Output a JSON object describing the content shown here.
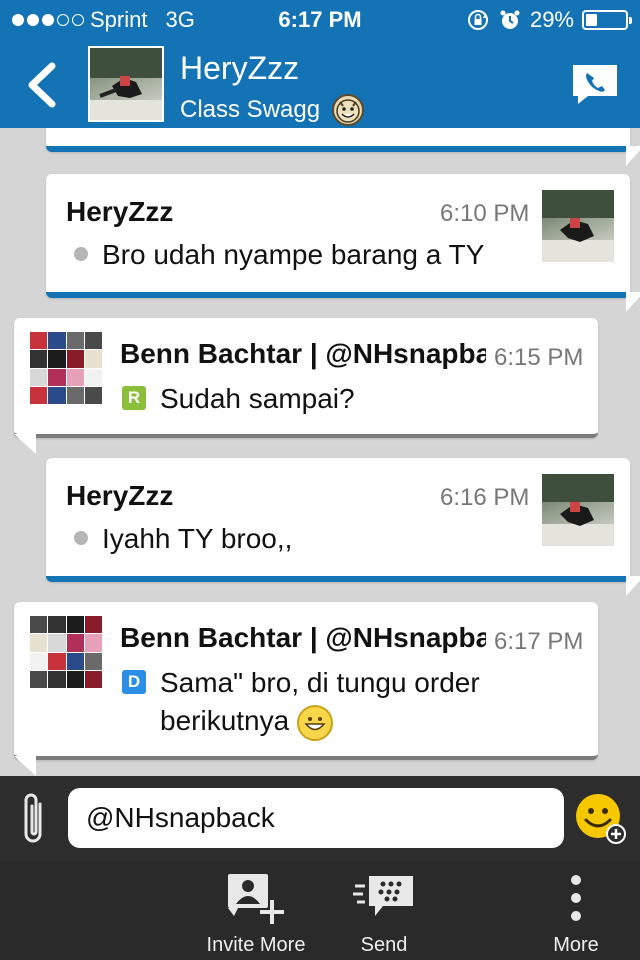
{
  "status_bar": {
    "carrier": "Sprint",
    "network": "3G",
    "time": "6:17 PM",
    "battery_percent": "29%",
    "battery_level": 0.29,
    "signal_bars": 3,
    "signal_max": 5,
    "icons": [
      "rotation-lock-icon",
      "alarm-icon",
      "battery-icon"
    ]
  },
  "header": {
    "contact_name": "HeryZzz",
    "contact_status": "Class Swagg",
    "status_emoji": "devil-emoji-icon",
    "back_icon": "chevron-left-icon",
    "call_icon": "phone-call-icon"
  },
  "messages": [
    {
      "sender": "HeryZzz",
      "time": "6:10 PM",
      "text": "Bro udah nyampe barang a TY",
      "side": "mine",
      "indicator": "dot"
    },
    {
      "sender": "Benn Bachtar | @NHsnapback",
      "time": "6:15 PM",
      "text": "Sudah sampai?",
      "side": "theirs",
      "indicator": "R"
    },
    {
      "sender": "HeryZzz",
      "time": "6:16 PM",
      "text": "Iyahh TY broo,,",
      "side": "mine",
      "indicator": "dot"
    },
    {
      "sender": "Benn Bachtar | @NHsnapback",
      "time": "6:17 PM",
      "text_line1": "Sama\" bro, di tungu order",
      "text_line2": "berikutnya",
      "side": "theirs",
      "indicator": "D",
      "emoji": "grin-emoji-icon"
    }
  ],
  "composer": {
    "value": "@NHsnapback",
    "attach_icon": "paperclip-icon",
    "emoji_icon": "smiley-add-icon"
  },
  "toolbar": {
    "invite_label": "Invite More",
    "send_label": "Send",
    "more_label": "More"
  },
  "colors": {
    "accent": "#1473b4",
    "background": "#d5d5d5",
    "bar_dark": "#2a2a2a"
  }
}
